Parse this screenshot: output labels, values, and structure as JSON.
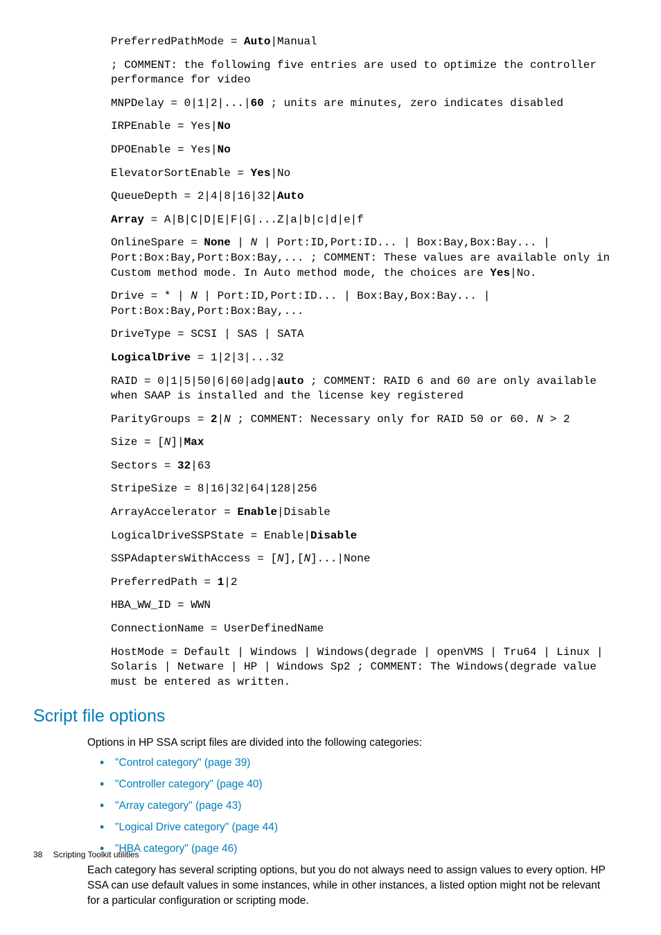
{
  "mono": {
    "l1a": "PreferredPathMode = ",
    "l1b": "Auto",
    "l1c": "|Manual",
    "l2": "; COMMENT: the following five entries are used to optimize the controller performance for video",
    "l3a": "MNPDelay = 0|1|2|...|",
    "l3b": "60",
    "l3c": " ; units are minutes, zero indicates disabled",
    "l4a": "IRPEnable = Yes|",
    "l4b": "No",
    "l5a": "DPOEnable = Yes|",
    "l5b": "No",
    "l6a": "ElevatorSortEnable = ",
    "l6b": "Yes",
    "l6c": "|No",
    "l7a": "QueueDepth = 2|4|8|16|32|",
    "l7b": "Auto",
    "l8a": "Array",
    "l8b": " = A|B|C|D|E|F|G|...Z|a|b|c|d|e|f",
    "l9a": "OnlineSpare = ",
    "l9b": "None",
    "l9c": " | ",
    "l9d": "N",
    "l9e": " | Port:ID,Port:ID... | Box:Bay,Box:Bay... | Port:Box:Bay,Port:Box:Bay,... ; COMMENT: These values are available only in Custom method mode. In Auto method mode, the choices are ",
    "l9f": "Yes",
    "l9g": "|No.",
    "l10a": "Drive = * | ",
    "l10b": "N",
    "l10c": " | Port:ID,Port:ID... | Box:Bay,Box:Bay... | Port:Box:Bay,Port:Box:Bay,...",
    "l11": "DriveType = SCSI | SAS | SATA",
    "l12a": "LogicalDrive",
    "l12b": " = 1|2|3|...32",
    "l13a": "RAID = 0|1|5|50|6|60|adg|",
    "l13b": "auto",
    "l13c": " ; COMMENT: RAID 6 and 60 are only available when SAAP is installed and the license key registered",
    "l14a": "ParityGroups = ",
    "l14b": "2",
    "l14c": "|",
    "l14d": "N",
    "l14e": " ; COMMENT: Necessary only for RAID 50 or 60. ",
    "l14f": "N",
    "l14g": " > 2",
    "l15a": "Size = [",
    "l15b": "N",
    "l15c": "]|",
    "l15d": "Max",
    "l16a": "Sectors = ",
    "l16b": "32",
    "l16c": "|63",
    "l17": "StripeSize = 8|16|32|64|128|256",
    "l18a": "ArrayAccelerator = ",
    "l18b": "Enable",
    "l18c": "|Disable",
    "l19a": "LogicalDriveSSPState = Enable|",
    "l19b": "Disable",
    "l20a": "SSPAdaptersWithAccess = [",
    "l20b": "N",
    "l20c": "],[",
    "l20d": "N",
    "l20e": "]...|None",
    "l21a": "PreferredPath = ",
    "l21b": "1",
    "l21c": "|2",
    "l22": "HBA_WW_ID = WWN",
    "l23": "ConnectionName = UserDefinedName",
    "l24": "HostMode = Default | Windows | Windows(degrade | openVMS | Tru64 | Linux | Solaris | Netware | HP | Windows Sp2 ; COMMENT: The Windows(degrade value must be entered as written."
  },
  "section_title": "Script file options",
  "intro": "Options in HP SSA script files are divided into the following categories:",
  "links": [
    "\"Control category\" (page 39)",
    "\"Controller category\" (page 40)",
    "\"Array category\" (page 43)",
    "\"Logical Drive category\" (page 44)",
    "\"HBA category\" (page 46)"
  ],
  "outro": "Each category has several scripting options, but you do not always need to assign values to every option. HP SSA can use default values in some instances, while in other instances, a listed option might not be relevant for a particular configuration or scripting mode.",
  "footer": {
    "page": "38",
    "title": "Scripting Toolkit utilities"
  }
}
